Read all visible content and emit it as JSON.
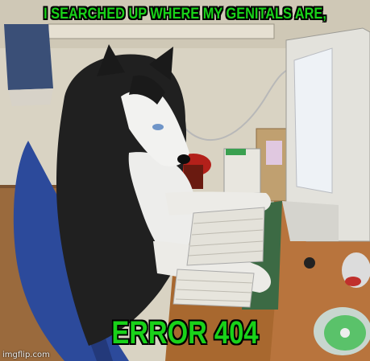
{
  "meme": {
    "top_text": "I SEARCHED UP WHERE MY GENITALS ARE,",
    "bottom_text": "ERROR 404",
    "watermark": "imgflip.com",
    "caption_color": "#19d219"
  }
}
